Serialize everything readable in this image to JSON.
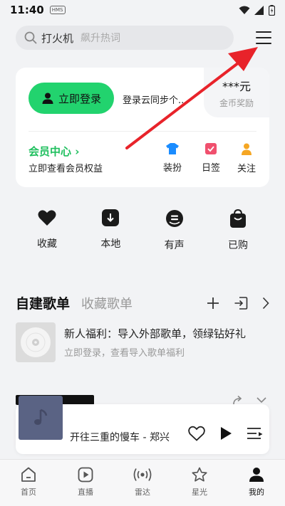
{
  "status_bar": {
    "time": "11:40",
    "badge": "HMS"
  },
  "search": {
    "keyword": "打火机",
    "hint": "飙升热词"
  },
  "login_card": {
    "login_button": "立即登录",
    "sync_text": "登录云同步个...",
    "reward_value": "***元",
    "reward_label": "金币奖励",
    "vip_title": "会员中心",
    "vip_subtitle": "立即查看会员权益",
    "quick_items": [
      {
        "label": "装扮",
        "icon": "shirt-icon",
        "color": "#1a8cff"
      },
      {
        "label": "日签",
        "icon": "calendar-check-icon",
        "color": "#f0506e"
      },
      {
        "label": "关注",
        "icon": "user-follow-icon",
        "color": "#f5a623"
      }
    ]
  },
  "functions": [
    {
      "label": "收藏",
      "icon": "heart-icon"
    },
    {
      "label": "本地",
      "icon": "download-icon"
    },
    {
      "label": "有声",
      "icon": "podcast-icon"
    },
    {
      "label": "已购",
      "icon": "shopping-bag-icon"
    }
  ],
  "playlists": {
    "tab_created": "自建歌单",
    "tab_collected": "收藏歌单",
    "item": {
      "title": "新人福利：导入外部歌单，领绿钻好礼",
      "subtitle": "立即登录，查看导入歌单福利"
    }
  },
  "player": {
    "song_title": "开往三重的慢车 - 郑兴"
  },
  "tabs": [
    {
      "label": "首页",
      "icon": "home-icon"
    },
    {
      "label": "直播",
      "icon": "live-play-icon"
    },
    {
      "label": "雷达",
      "icon": "radar-icon"
    },
    {
      "label": "星光",
      "icon": "star-icon"
    },
    {
      "label": "我的",
      "icon": "profile-icon"
    }
  ],
  "colors": {
    "accent": "#22d36e",
    "vip_green": "#1fbf5e",
    "annotation_arrow": "#e8232a"
  }
}
